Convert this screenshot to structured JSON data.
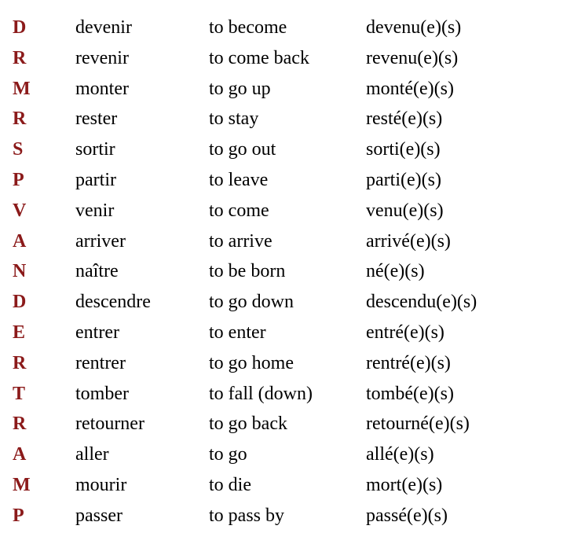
{
  "rows": [
    {
      "letter": "D",
      "verb": "devenir",
      "english": "to become",
      "participle": "devenu(e)(s)"
    },
    {
      "letter": "R",
      "verb": "revenir",
      "english": "to come back",
      "participle": "revenu(e)(s)"
    },
    {
      "letter": "M",
      "verb": "monter",
      "english": "to go up",
      "participle": "monté(e)(s)"
    },
    {
      "letter": "R",
      "verb": "rester",
      "english": "to stay",
      "participle": "resté(e)(s)"
    },
    {
      "letter": "S",
      "verb": "sortir",
      "english": "to go out",
      "participle": "sorti(e)(s)"
    },
    {
      "letter": "P",
      "verb": "partir",
      "english": "to leave",
      "participle": "parti(e)(s)"
    },
    {
      "letter": "V",
      "verb": "venir",
      "english": "to come",
      "participle": "venu(e)(s)"
    },
    {
      "letter": "A",
      "verb": "arriver",
      "english": "to arrive",
      "participle": "arrivé(e)(s)"
    },
    {
      "letter": "N",
      "verb": "naître",
      "english": "to be born",
      "participle": "né(e)(s)"
    },
    {
      "letter": "D",
      "verb": "descendre",
      "english": "to go down",
      "participle": "descendu(e)(s)"
    },
    {
      "letter": "E",
      "verb": "entrer",
      "english": "to enter",
      "participle": "entré(e)(s)"
    },
    {
      "letter": "R",
      "verb": "rentrer",
      "english": "to go home",
      "participle": "rentré(e)(s)"
    },
    {
      "letter": "T",
      "verb": "tomber",
      "english": "to fall (down)",
      "participle": "tombé(e)(s)"
    },
    {
      "letter": "R",
      "verb": "retourner",
      "english": "to go back",
      "participle": "retourné(e)(s)"
    },
    {
      "letter": "A",
      "verb": "aller",
      "english": "to go",
      "participle": "allé(e)(s)"
    },
    {
      "letter": "M",
      "verb": "mourir",
      "english": "to die",
      "participle": "mort(e)(s)"
    },
    {
      "letter": "P",
      "verb": "passer",
      "english": "to pass by",
      "participle": "passé(e)(s)"
    }
  ]
}
